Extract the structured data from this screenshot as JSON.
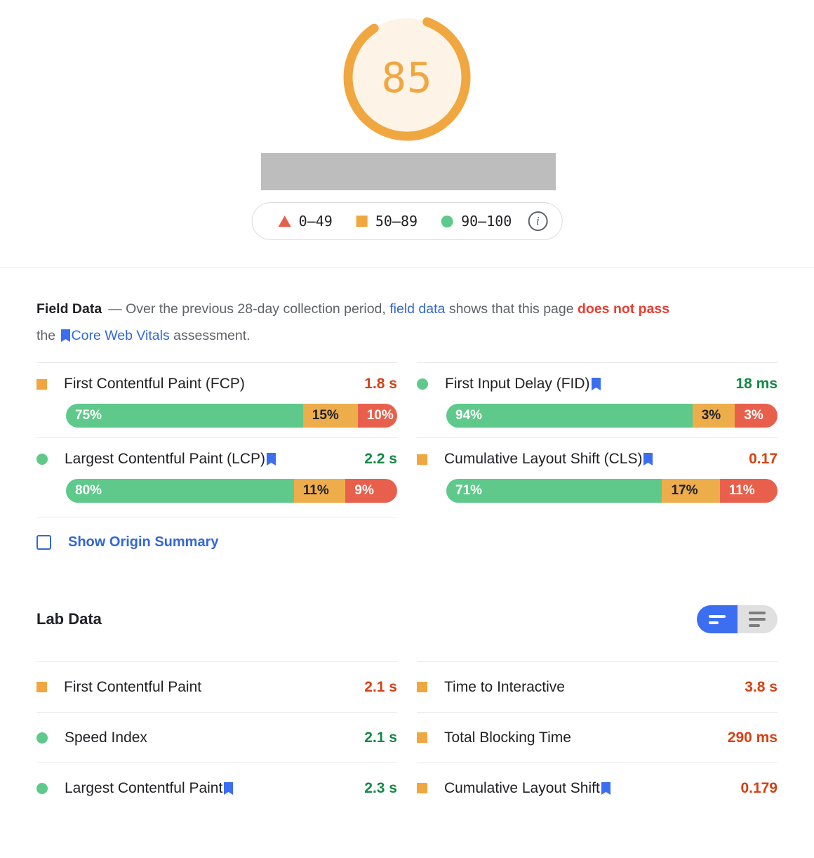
{
  "score": {
    "value": "85",
    "percent": 85,
    "color": "#f0a73f",
    "track_color": "#fdf3e6"
  },
  "legend": {
    "items": [
      {
        "icon": "triangle-icon",
        "label": "0–49",
        "color": "#e8604c"
      },
      {
        "icon": "square-icon",
        "label": "50–89",
        "color": "#f0a73f"
      },
      {
        "icon": "circle-icon",
        "label": "90–100",
        "color": "#5ec98a"
      }
    ],
    "info_icon": "i"
  },
  "field": {
    "title": "Field Data",
    "dash": "—",
    "desc_1": "Over the previous 28-day collection period,",
    "link_1": "field data",
    "desc_2": "shows that this page",
    "fail_text": "does not pass",
    "desc_3": "the",
    "link_2": "Core Web Vitals",
    "desc_4": "assessment.",
    "metrics": [
      {
        "status": "orange",
        "name": "First Contentful Paint (FCP)",
        "bookmark": false,
        "value": "1.8 s",
        "value_color": "orange",
        "good": "75%",
        "avg": "15%",
        "bad": "10%",
        "good_pct": 75,
        "avg_pct": 15,
        "bad_pct": 10
      },
      {
        "status": "green",
        "name": "First Input Delay (FID)",
        "bookmark": true,
        "value": "18 ms",
        "value_color": "green",
        "good": "94%",
        "avg": "3%",
        "bad": "3%",
        "good_pct": 78,
        "avg_pct": 11,
        "bad_pct": 11
      },
      {
        "status": "green",
        "name": "Largest Contentful Paint (LCP)",
        "bookmark": true,
        "value": "2.2 s",
        "value_color": "green",
        "good": "80%",
        "avg": "11%",
        "bad": "9%",
        "good_pct": 72,
        "avg_pct": 14,
        "bad_pct": 14
      },
      {
        "status": "orange",
        "name": "Cumulative Layout Shift (CLS)",
        "bookmark": true,
        "value": "0.17",
        "value_color": "orange",
        "good": "71%",
        "avg": "17%",
        "bad": "11%",
        "good_pct": 68,
        "avg_pct": 16,
        "bad_pct": 16
      }
    ],
    "origin_summary_label": "Show Origin Summary",
    "origin_summary_checked": false
  },
  "lab": {
    "title": "Lab Data",
    "view_toggle": {
      "compact_icon": "compact-view-icon",
      "expanded_icon": "expanded-view-icon",
      "selected": "compact"
    },
    "metrics": [
      {
        "status": "orange",
        "name": "First Contentful Paint",
        "bookmark": false,
        "value": "2.1 s",
        "value_color": "orange"
      },
      {
        "status": "orange",
        "name": "Time to Interactive",
        "bookmark": false,
        "value": "3.8 s",
        "value_color": "orange"
      },
      {
        "status": "green",
        "name": "Speed Index",
        "bookmark": false,
        "value": "2.1 s",
        "value_color": "green"
      },
      {
        "status": "orange",
        "name": "Total Blocking Time",
        "bookmark": false,
        "value": "290 ms",
        "value_color": "orange"
      },
      {
        "status": "green",
        "name": "Largest Contentful Paint",
        "bookmark": true,
        "value": "2.3 s",
        "value_color": "green"
      },
      {
        "status": "orange",
        "name": "Cumulative Layout Shift",
        "bookmark": true,
        "value": "0.179",
        "value_color": "orange"
      }
    ]
  }
}
